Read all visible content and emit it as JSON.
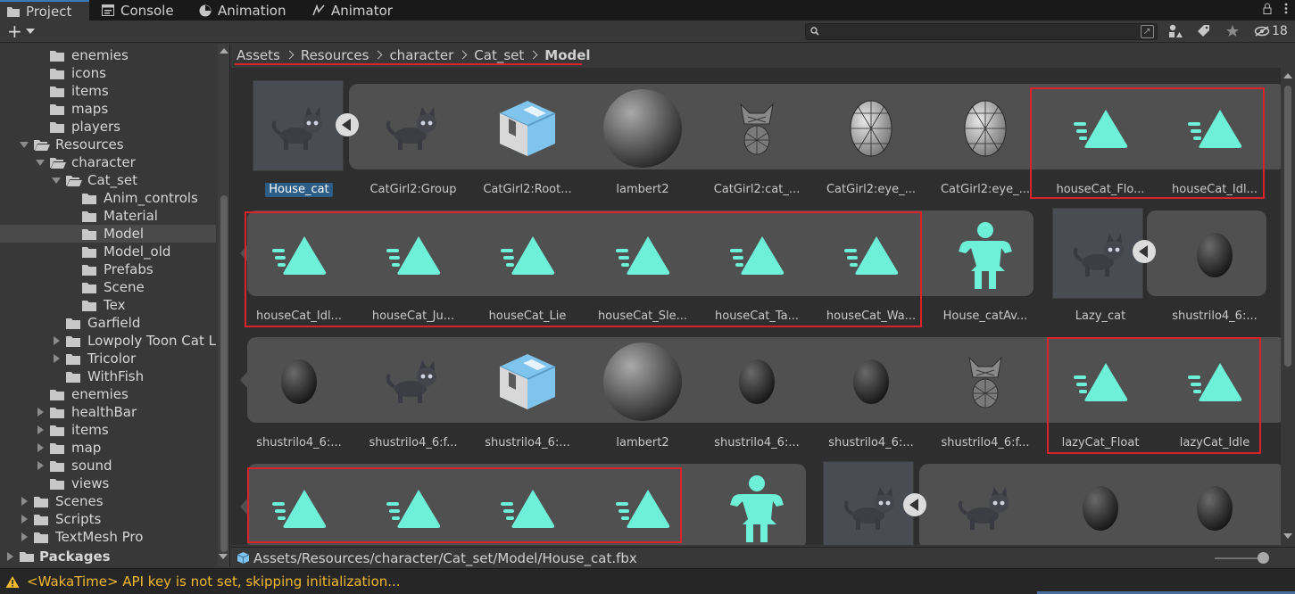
{
  "tabs": [
    {
      "label": "Project",
      "icon": "folder-icon",
      "active": true
    },
    {
      "label": "Console",
      "icon": "console-icon",
      "active": false
    },
    {
      "label": "Animation",
      "icon": "animation-icon",
      "active": false
    },
    {
      "label": "Animator",
      "icon": "animator-icon",
      "active": false
    }
  ],
  "toolbar": {
    "create_label": "+",
    "search_placeholder": "",
    "search_value": "",
    "hidden_count": "18"
  },
  "tree": [
    {
      "label": "enemies",
      "depth": 2,
      "arrow": "none",
      "icon": "folder-icon"
    },
    {
      "label": "icons",
      "depth": 2,
      "arrow": "none",
      "icon": "folder-icon"
    },
    {
      "label": "items",
      "depth": 2,
      "arrow": "none",
      "icon": "folder-icon"
    },
    {
      "label": "maps",
      "depth": 2,
      "arrow": "none",
      "icon": "folder-icon"
    },
    {
      "label": "players",
      "depth": 2,
      "arrow": "none",
      "icon": "folder-icon"
    },
    {
      "label": "Resources",
      "depth": 1,
      "arrow": "down",
      "icon": "open-folder-icon"
    },
    {
      "label": "character",
      "depth": 2,
      "arrow": "down",
      "icon": "open-folder-icon"
    },
    {
      "label": "Cat_set",
      "depth": 3,
      "arrow": "down",
      "icon": "open-folder-icon"
    },
    {
      "label": "Anim_controls",
      "depth": 4,
      "arrow": "none",
      "icon": "folder-icon"
    },
    {
      "label": "Material",
      "depth": 4,
      "arrow": "none",
      "icon": "folder-icon"
    },
    {
      "label": "Model",
      "depth": 4,
      "arrow": "none",
      "icon": "folder-icon",
      "selected": true
    },
    {
      "label": "Model_old",
      "depth": 4,
      "arrow": "none",
      "icon": "folder-icon"
    },
    {
      "label": "Prefabs",
      "depth": 4,
      "arrow": "none",
      "icon": "folder-icon"
    },
    {
      "label": "Scene",
      "depth": 4,
      "arrow": "none",
      "icon": "folder-icon"
    },
    {
      "label": "Tex",
      "depth": 4,
      "arrow": "none",
      "icon": "folder-icon"
    },
    {
      "label": "Garfield",
      "depth": 3,
      "arrow": "none",
      "icon": "folder-icon"
    },
    {
      "label": "Lowpoly Toon Cat L",
      "depth": 3,
      "arrow": "right",
      "icon": "folder-icon"
    },
    {
      "label": "Tricolor",
      "depth": 3,
      "arrow": "right",
      "icon": "folder-icon"
    },
    {
      "label": "WithFish",
      "depth": 3,
      "arrow": "none",
      "icon": "folder-icon"
    },
    {
      "label": "enemies",
      "depth": 2,
      "arrow": "none",
      "icon": "folder-icon"
    },
    {
      "label": "healthBar",
      "depth": 2,
      "arrow": "right",
      "icon": "folder-icon"
    },
    {
      "label": "items",
      "depth": 2,
      "arrow": "right",
      "icon": "folder-icon"
    },
    {
      "label": "map",
      "depth": 2,
      "arrow": "right",
      "icon": "folder-icon"
    },
    {
      "label": "sound",
      "depth": 2,
      "arrow": "right",
      "icon": "folder-icon"
    },
    {
      "label": "views",
      "depth": 2,
      "arrow": "none",
      "icon": "folder-icon"
    },
    {
      "label": "Scenes",
      "depth": 1,
      "arrow": "right",
      "icon": "folder-icon"
    },
    {
      "label": "Scripts",
      "depth": 1,
      "arrow": "right",
      "icon": "folder-icon"
    },
    {
      "label": "TextMesh Pro",
      "depth": 1,
      "arrow": "right",
      "icon": "folder-icon"
    }
  ],
  "packages_label": "Packages",
  "breadcrumb": [
    "Assets",
    "Resources",
    "character",
    "Cat_set",
    "Model"
  ],
  "assets": [
    {
      "label": "House_cat",
      "icon": "cat-model-icon",
      "selected": true
    },
    {
      "label": "CatGirl2:Group",
      "icon": "cat-model-icon"
    },
    {
      "label": "CatGirl2:Root...",
      "icon": "prefab-box-icon"
    },
    {
      "label": "lambert2",
      "icon": "material-sphere-icon"
    },
    {
      "label": "CatGirl2:cat_...",
      "icon": "wire-cat-icon"
    },
    {
      "label": "CatGirl2:eye_...",
      "icon": "wire-eye-icon"
    },
    {
      "label": "CatGirl2:eye_...",
      "icon": "wire-eye-icon"
    },
    {
      "label": "houseCat_Flo...",
      "icon": "animation-clip-icon"
    },
    {
      "label": "houseCat_Idl...",
      "icon": "animation-clip-icon"
    },
    {
      "label": "houseCat_Idl...",
      "icon": "animation-clip-icon"
    },
    {
      "label": "houseCat_Ju...",
      "icon": "animation-clip-icon"
    },
    {
      "label": "houseCat_Lie",
      "icon": "animation-clip-icon"
    },
    {
      "label": "houseCat_Sle...",
      "icon": "animation-clip-icon"
    },
    {
      "label": "houseCat_Ta...",
      "icon": "animation-clip-icon"
    },
    {
      "label": "houseCat_Wa...",
      "icon": "animation-clip-icon"
    },
    {
      "label": "House_catAv...",
      "icon": "avatar-icon"
    },
    {
      "label": "Lazy_cat",
      "icon": "cat-model-icon"
    },
    {
      "label": "shustrilo4_6:...",
      "icon": "dark-mesh-icon"
    },
    {
      "label": "shustrilo4_6:...",
      "icon": "dark-mesh-icon"
    },
    {
      "label": "shustrilo4_6:f...",
      "icon": "cat-model-icon"
    },
    {
      "label": "shustrilo4_6:...",
      "icon": "prefab-box-icon"
    },
    {
      "label": "lambert2",
      "icon": "material-sphere-icon"
    },
    {
      "label": "shustrilo4_6:...",
      "icon": "dark-mesh-icon"
    },
    {
      "label": "shustrilo4_6:...",
      "icon": "dark-mesh-icon"
    },
    {
      "label": "shustrilo4_6:f...",
      "icon": "wire-cat-icon"
    },
    {
      "label": "lazyCat_Float",
      "icon": "animation-clip-icon"
    },
    {
      "label": "lazyCat_Idle",
      "icon": "animation-clip-icon"
    },
    {
      "label": "",
      "icon": "animation-clip-icon"
    },
    {
      "label": "",
      "icon": "animation-clip-icon"
    },
    {
      "label": "",
      "icon": "animation-clip-icon"
    },
    {
      "label": "",
      "icon": "animation-clip-icon"
    },
    {
      "label": "",
      "icon": "avatar-icon"
    },
    {
      "label": "",
      "icon": "cat-model-icon"
    },
    {
      "label": "",
      "icon": "cat-model-icon"
    },
    {
      "label": "",
      "icon": "dark-mesh-icon"
    },
    {
      "label": "",
      "icon": "dark-mesh-icon"
    }
  ],
  "selected_path": "Assets/Resources/character/Cat_set/Model/House_cat.fbx",
  "status_message": "<WakaTime> API key is not set, skipping initialization...",
  "colors": {
    "accent": "#3a79bb",
    "highlight_box": "#d9222a",
    "clip_icon": "#6ef0d8",
    "warning": "#f2b82f"
  }
}
